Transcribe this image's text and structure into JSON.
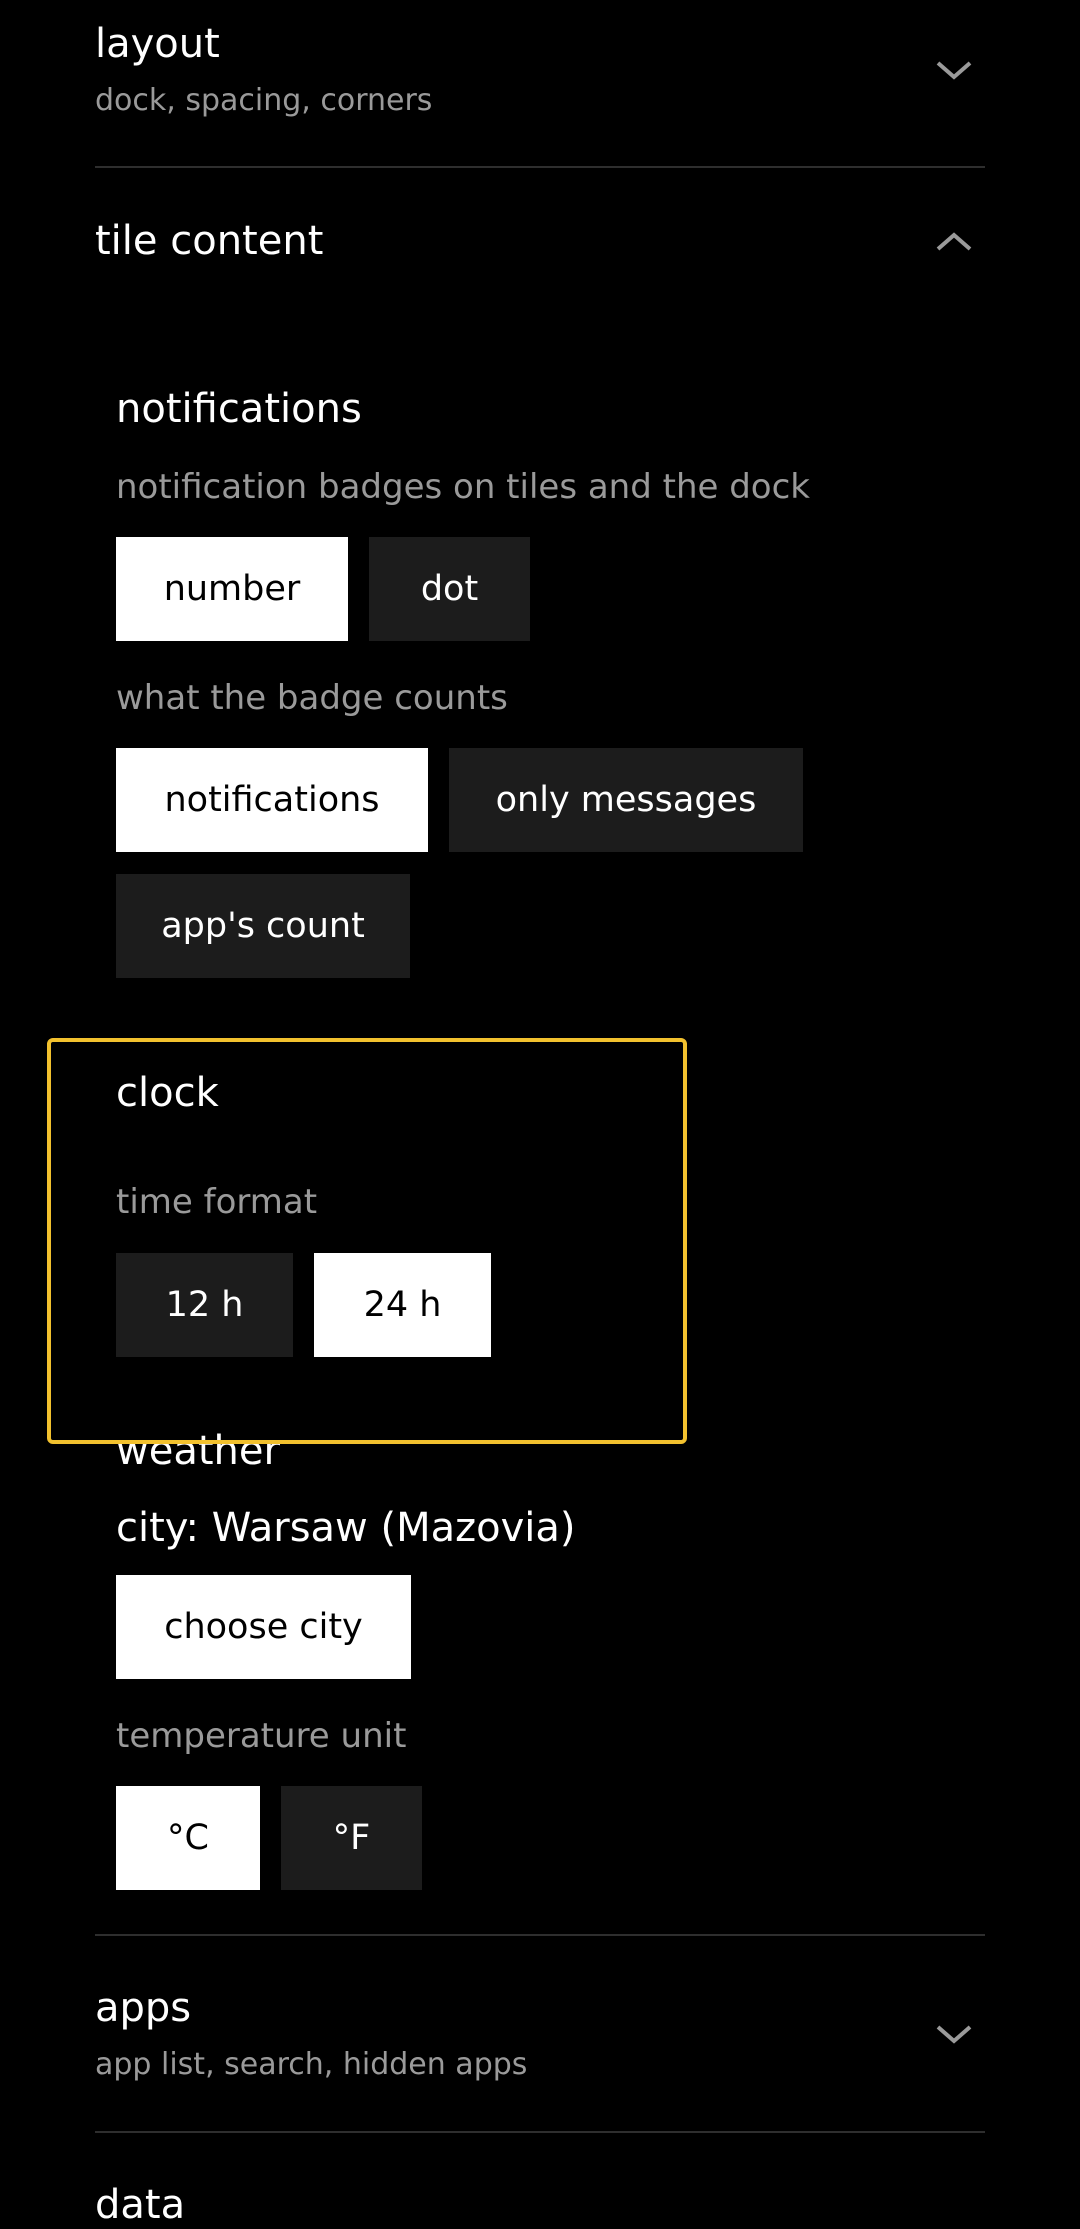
{
  "colors": {
    "background": "#000000",
    "selected_option_bg": "#ffffff",
    "unselected_option_bg": "#1c1c1c",
    "highlight_border": "#f2c12e",
    "secondary_text": "#9a9a9a"
  },
  "sections": {
    "layout": {
      "title": "layout",
      "subtitle": "dock, spacing, corners",
      "icon": "chevron-down-icon"
    },
    "tile_content": {
      "title": "tile content",
      "icon": "chevron-up-icon"
    },
    "apps": {
      "title": "apps",
      "subtitle": "app list, search, hidden apps",
      "icon": "chevron-down-icon"
    },
    "data": {
      "title": "data"
    }
  },
  "notifications": {
    "title": "notifications",
    "badge_hint": "notification badges on tiles and the dock",
    "badge_options": [
      "number",
      "dot"
    ],
    "badge_selected": "number",
    "count_hint": "what the badge counts",
    "count_options": [
      "notifications",
      "only messages",
      "app's count"
    ],
    "count_selected": "notifications"
  },
  "clock": {
    "title": "clock",
    "format_hint": "time format",
    "format_options": [
      "12 h",
      "24 h"
    ],
    "format_selected": "24 h"
  },
  "weather": {
    "title": "weather",
    "city_label": "city: Warsaw (Mazovia)",
    "choose_city": "choose city",
    "unit_hint": "temperature unit",
    "unit_options": [
      "°C",
      "°F"
    ],
    "unit_selected": "°C"
  }
}
